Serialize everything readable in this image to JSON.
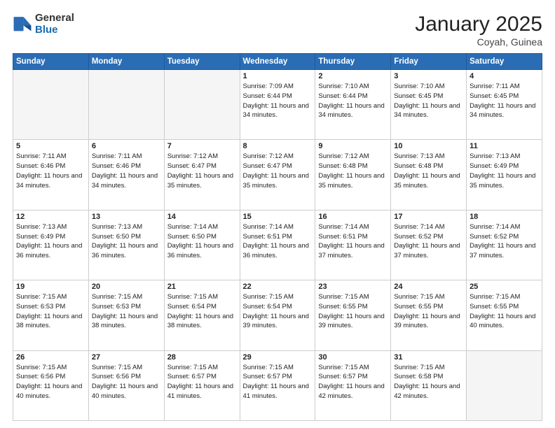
{
  "logo": {
    "general": "General",
    "blue": "Blue"
  },
  "title": {
    "month": "January 2025",
    "location": "Coyah, Guinea"
  },
  "weekdays": [
    "Sunday",
    "Monday",
    "Tuesday",
    "Wednesday",
    "Thursday",
    "Friday",
    "Saturday"
  ],
  "weeks": [
    [
      {
        "day": "",
        "info": ""
      },
      {
        "day": "",
        "info": ""
      },
      {
        "day": "",
        "info": ""
      },
      {
        "day": "1",
        "info": "Sunrise: 7:09 AM\nSunset: 6:44 PM\nDaylight: 11 hours and 34 minutes."
      },
      {
        "day": "2",
        "info": "Sunrise: 7:10 AM\nSunset: 6:44 PM\nDaylight: 11 hours and 34 minutes."
      },
      {
        "day": "3",
        "info": "Sunrise: 7:10 AM\nSunset: 6:45 PM\nDaylight: 11 hours and 34 minutes."
      },
      {
        "day": "4",
        "info": "Sunrise: 7:11 AM\nSunset: 6:45 PM\nDaylight: 11 hours and 34 minutes."
      }
    ],
    [
      {
        "day": "5",
        "info": "Sunrise: 7:11 AM\nSunset: 6:46 PM\nDaylight: 11 hours and 34 minutes."
      },
      {
        "day": "6",
        "info": "Sunrise: 7:11 AM\nSunset: 6:46 PM\nDaylight: 11 hours and 34 minutes."
      },
      {
        "day": "7",
        "info": "Sunrise: 7:12 AM\nSunset: 6:47 PM\nDaylight: 11 hours and 35 minutes."
      },
      {
        "day": "8",
        "info": "Sunrise: 7:12 AM\nSunset: 6:47 PM\nDaylight: 11 hours and 35 minutes."
      },
      {
        "day": "9",
        "info": "Sunrise: 7:12 AM\nSunset: 6:48 PM\nDaylight: 11 hours and 35 minutes."
      },
      {
        "day": "10",
        "info": "Sunrise: 7:13 AM\nSunset: 6:48 PM\nDaylight: 11 hours and 35 minutes."
      },
      {
        "day": "11",
        "info": "Sunrise: 7:13 AM\nSunset: 6:49 PM\nDaylight: 11 hours and 35 minutes."
      }
    ],
    [
      {
        "day": "12",
        "info": "Sunrise: 7:13 AM\nSunset: 6:49 PM\nDaylight: 11 hours and 36 minutes."
      },
      {
        "day": "13",
        "info": "Sunrise: 7:13 AM\nSunset: 6:50 PM\nDaylight: 11 hours and 36 minutes."
      },
      {
        "day": "14",
        "info": "Sunrise: 7:14 AM\nSunset: 6:50 PM\nDaylight: 11 hours and 36 minutes."
      },
      {
        "day": "15",
        "info": "Sunrise: 7:14 AM\nSunset: 6:51 PM\nDaylight: 11 hours and 36 minutes."
      },
      {
        "day": "16",
        "info": "Sunrise: 7:14 AM\nSunset: 6:51 PM\nDaylight: 11 hours and 37 minutes."
      },
      {
        "day": "17",
        "info": "Sunrise: 7:14 AM\nSunset: 6:52 PM\nDaylight: 11 hours and 37 minutes."
      },
      {
        "day": "18",
        "info": "Sunrise: 7:14 AM\nSunset: 6:52 PM\nDaylight: 11 hours and 37 minutes."
      }
    ],
    [
      {
        "day": "19",
        "info": "Sunrise: 7:15 AM\nSunset: 6:53 PM\nDaylight: 11 hours and 38 minutes."
      },
      {
        "day": "20",
        "info": "Sunrise: 7:15 AM\nSunset: 6:53 PM\nDaylight: 11 hours and 38 minutes."
      },
      {
        "day": "21",
        "info": "Sunrise: 7:15 AM\nSunset: 6:54 PM\nDaylight: 11 hours and 38 minutes."
      },
      {
        "day": "22",
        "info": "Sunrise: 7:15 AM\nSunset: 6:54 PM\nDaylight: 11 hours and 39 minutes."
      },
      {
        "day": "23",
        "info": "Sunrise: 7:15 AM\nSunset: 6:55 PM\nDaylight: 11 hours and 39 minutes."
      },
      {
        "day": "24",
        "info": "Sunrise: 7:15 AM\nSunset: 6:55 PM\nDaylight: 11 hours and 39 minutes."
      },
      {
        "day": "25",
        "info": "Sunrise: 7:15 AM\nSunset: 6:55 PM\nDaylight: 11 hours and 40 minutes."
      }
    ],
    [
      {
        "day": "26",
        "info": "Sunrise: 7:15 AM\nSunset: 6:56 PM\nDaylight: 11 hours and 40 minutes."
      },
      {
        "day": "27",
        "info": "Sunrise: 7:15 AM\nSunset: 6:56 PM\nDaylight: 11 hours and 40 minutes."
      },
      {
        "day": "28",
        "info": "Sunrise: 7:15 AM\nSunset: 6:57 PM\nDaylight: 11 hours and 41 minutes."
      },
      {
        "day": "29",
        "info": "Sunrise: 7:15 AM\nSunset: 6:57 PM\nDaylight: 11 hours and 41 minutes."
      },
      {
        "day": "30",
        "info": "Sunrise: 7:15 AM\nSunset: 6:57 PM\nDaylight: 11 hours and 42 minutes."
      },
      {
        "day": "31",
        "info": "Sunrise: 7:15 AM\nSunset: 6:58 PM\nDaylight: 11 hours and 42 minutes."
      },
      {
        "day": "",
        "info": ""
      }
    ]
  ]
}
